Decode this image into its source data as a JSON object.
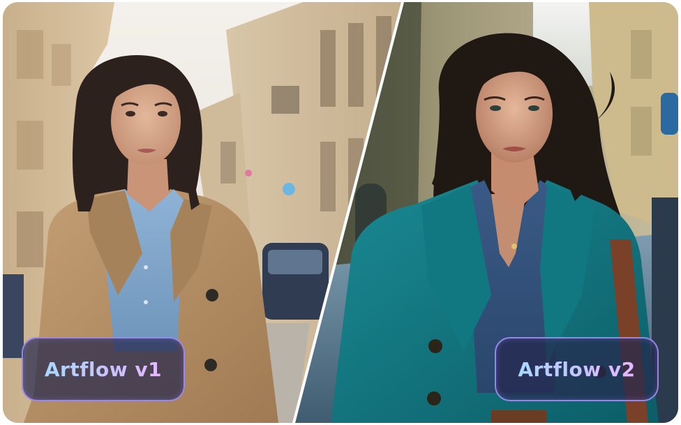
{
  "comparison": {
    "left_label": "Artflow v1",
    "right_label": "Artflow v2"
  },
  "colors": {
    "label_background": "#26284e",
    "label_border": "#a896ff",
    "label_text_gradient_start": "#a9d8ff",
    "label_text_gradient_end": "#e6b8ff",
    "divider": "#ffffff",
    "v1_coat": "#b48e63",
    "v2_coat": "#11707a"
  }
}
